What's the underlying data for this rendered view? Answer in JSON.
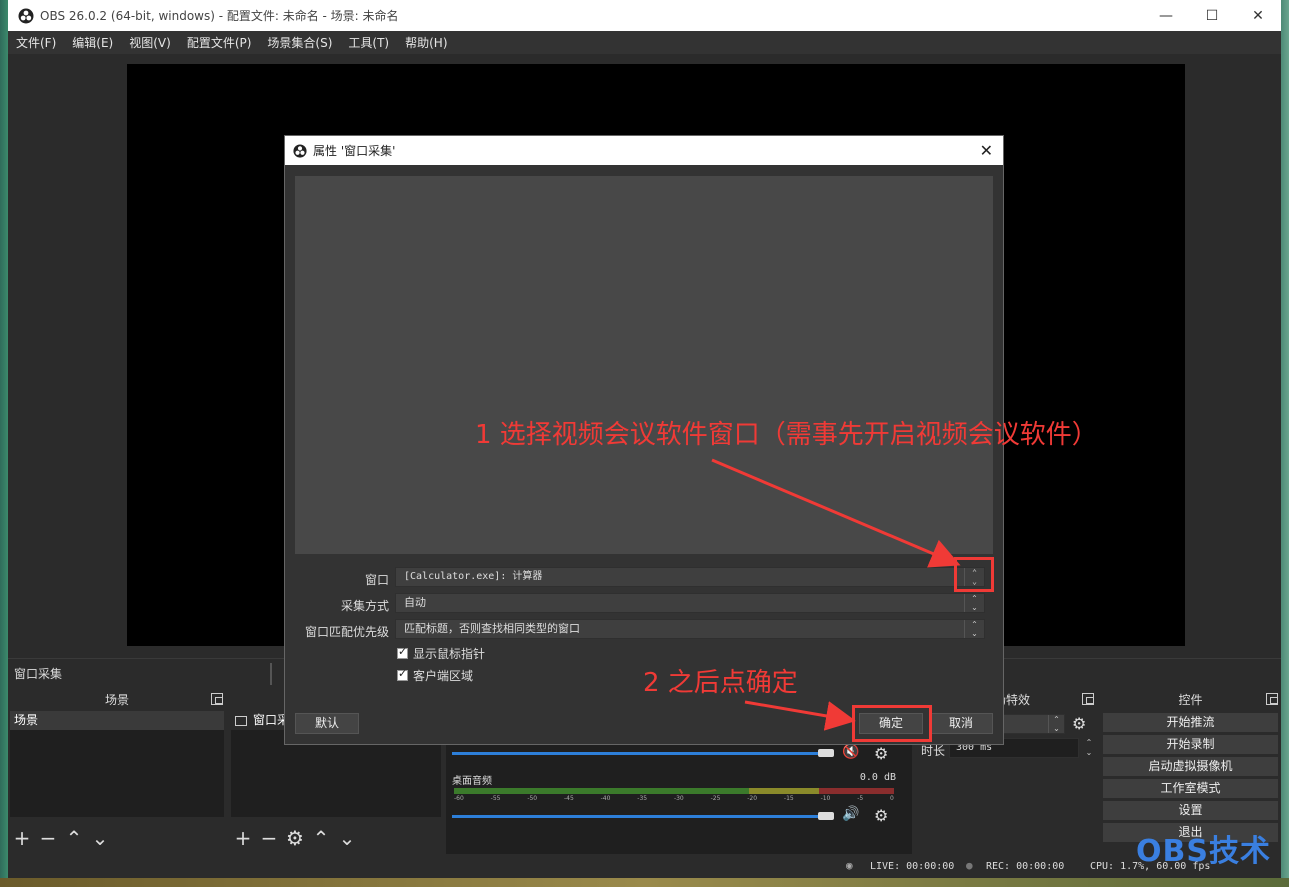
{
  "window": {
    "title": "OBS 26.0.2 (64-bit, windows) - 配置文件: 未命名 - 场景: 未命名",
    "minimize": "—",
    "maximize": "☐",
    "close": "✕"
  },
  "menu": [
    "文件(F)",
    "编辑(E)",
    "视图(V)",
    "配置文件(P)",
    "场景集合(S)",
    "工具(T)",
    "帮助(H)"
  ],
  "source_toolbar": {
    "source_name": "窗口采集"
  },
  "docks": {
    "scenes": {
      "title": "场景",
      "items": [
        "场景"
      ]
    },
    "sources": {
      "item": "窗口采"
    },
    "transitions": {
      "title": "转场特效",
      "duration_label": "时长",
      "duration_value": "300 ms"
    },
    "controls": {
      "title": "控件",
      "buttons": [
        "开始推流",
        "开始录制",
        "启动虚拟摄像机",
        "工作室模式",
        "设置",
        "退出"
      ]
    }
  },
  "mixer": {
    "track2_name": "桌面音频",
    "track2_db": "0.0 dB",
    "ticks": [
      "-60",
      "-55",
      "-50",
      "-45",
      "-40",
      "-35",
      "-30",
      "-25",
      "-20",
      "-15",
      "-10",
      "-5",
      "0"
    ],
    "track1_volume": 1.0,
    "track2_volume": 1.0
  },
  "status": {
    "live": "LIVE: 00:00:00",
    "rec": "REC: 00:00:00",
    "cpu": "CPU: 1.7%, 60.00 fps"
  },
  "dialog": {
    "title": "属性 '窗口采集'",
    "close": "✕",
    "fields": [
      {
        "label": "窗口",
        "value": "[Calculator.exe]: 计算器"
      },
      {
        "label": "采集方式",
        "value": "自动"
      },
      {
        "label": "窗口匹配优先级",
        "value": "匹配标题，否则查找相同类型的窗口"
      }
    ],
    "checkboxes": [
      "显示鼠标指针",
      "客户端区域"
    ],
    "buttons": {
      "defaults": "默认",
      "ok": "确定",
      "cancel": "取消"
    }
  },
  "annotations": {
    "step1": "1 选择视频会议软件窗口（需事先开启视频会议软件）",
    "step2": "2 之后点确定",
    "color": "#f03a36"
  },
  "watermark": "OBS技术"
}
